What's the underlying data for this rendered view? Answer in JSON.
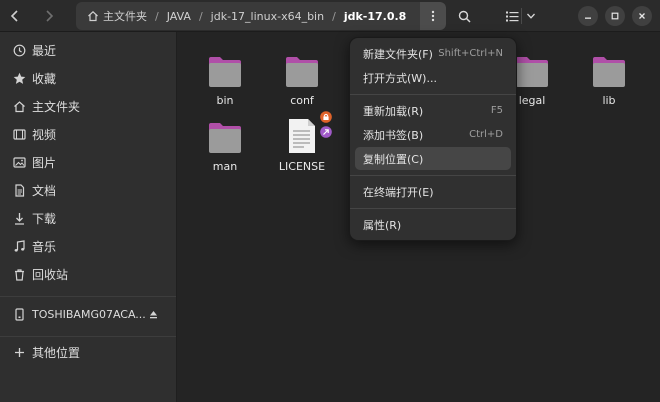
{
  "path": {
    "home": "主文件夹",
    "crumbs": [
      "JAVA",
      "jdk-17_linux-x64_bin"
    ],
    "current": "jdk-17.0.8"
  },
  "icons": {
    "back": "chevron-left-icon",
    "forward": "chevron-right-icon",
    "home": "home-icon",
    "path_menu": "vertical-ellipsis-icon",
    "search": "search-icon",
    "view": "list-view-icon",
    "view_options": "chevron-down-icon",
    "minimize": "minimize-icon",
    "maximize": "maximize-icon",
    "close": "close-icon"
  },
  "sidebar": {
    "items": [
      {
        "label": "最近",
        "icon": "clock-icon"
      },
      {
        "label": "收藏",
        "icon": "star-icon"
      },
      {
        "label": "主文件夹",
        "icon": "home-icon"
      },
      {
        "label": "视频",
        "icon": "film-icon"
      },
      {
        "label": "图片",
        "icon": "picture-icon"
      },
      {
        "label": "文档",
        "icon": "document-icon"
      },
      {
        "label": "下载",
        "icon": "download-icon"
      },
      {
        "label": "音乐",
        "icon": "music-icon"
      },
      {
        "label": "回收站",
        "icon": "trash-icon"
      }
    ],
    "drive": {
      "label": "TOSHIBAMG07ACA...",
      "icon": "drive-icon",
      "eject_icon": "eject-icon"
    },
    "other": {
      "label": "其他位置",
      "icon": "plus-icon"
    }
  },
  "files": [
    {
      "name": "bin",
      "type": "folder"
    },
    {
      "name": "conf",
      "type": "folder"
    },
    {
      "name": "legal",
      "type": "folder"
    },
    {
      "name": "lib",
      "type": "folder"
    },
    {
      "name": "man",
      "type": "folder"
    },
    {
      "name": "LICENSE",
      "type": "text-file",
      "emblems": [
        "lock-emblem-icon",
        "symlink-emblem-icon"
      ]
    }
  ],
  "context_menu": {
    "items": [
      {
        "label": "新建文件夹(F)",
        "accel": "Shift+Ctrl+N"
      },
      {
        "label": "打开方式(W)...",
        "accel": ""
      },
      {
        "label": "重新加载(R)",
        "accel": "F5"
      },
      {
        "label": "添加书签(B)",
        "accel": "Ctrl+D"
      },
      {
        "label": "复制位置(C)",
        "accel": ""
      },
      {
        "label": "在终端打开(E)",
        "accel": ""
      },
      {
        "label": "属性(R)",
        "accel": ""
      }
    ]
  },
  "colors": {
    "folder": "#9b9b9b",
    "folder_tab": "#b04fa8",
    "emblem_lock": "#e0632a",
    "emblem_link": "#a05ac8",
    "menu_hover": "#464646"
  }
}
